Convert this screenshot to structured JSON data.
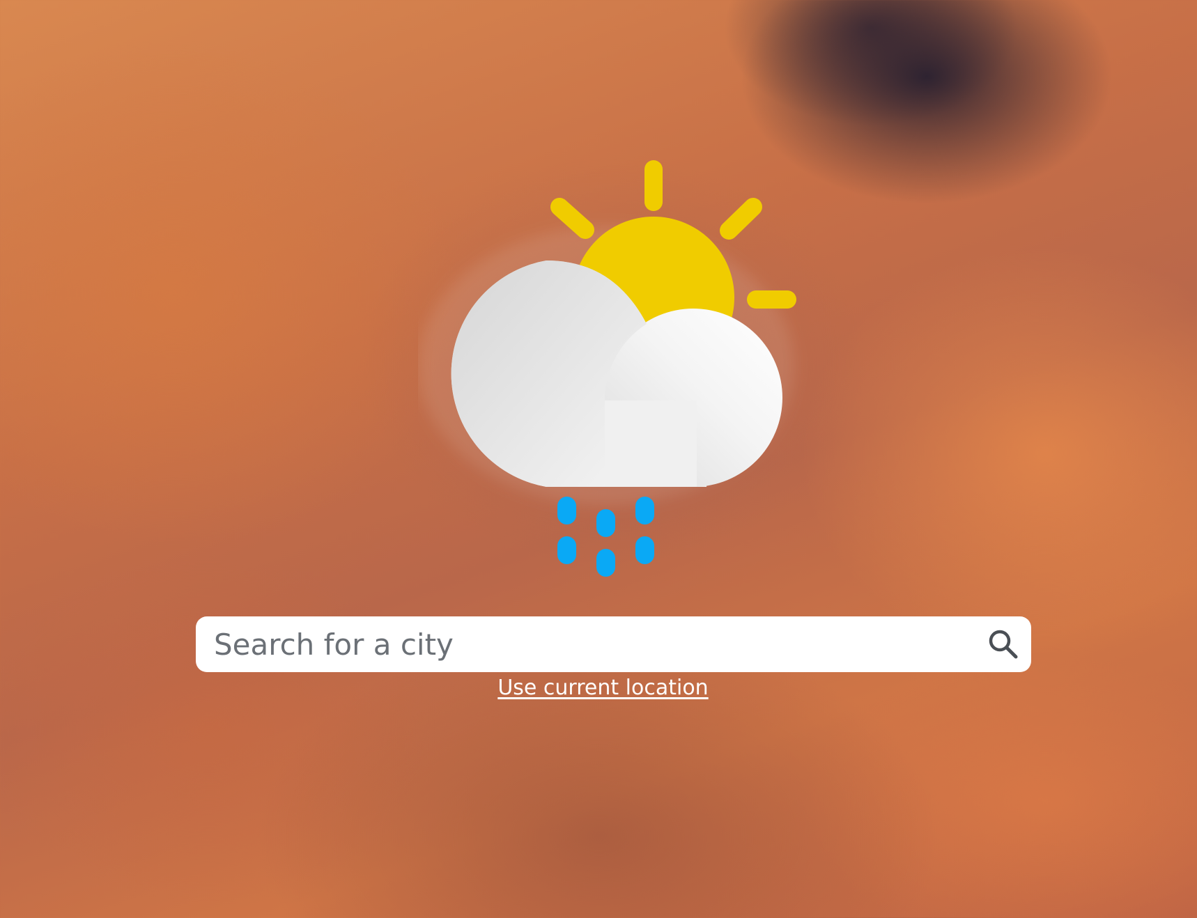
{
  "search": {
    "placeholder": "Search for a city",
    "value": "",
    "button_icon": "search-icon"
  },
  "location_link": {
    "label": "Use current location"
  },
  "weather_icon": {
    "name": "partly-cloudy-rain-icon",
    "colors": {
      "sun": "#f0cc00",
      "cloud": "#f1f1f1",
      "rain": "#0aa9f5"
    }
  },
  "background": {
    "description_colors": [
      "#d98850",
      "#c76f47",
      "#2a2230"
    ]
  }
}
